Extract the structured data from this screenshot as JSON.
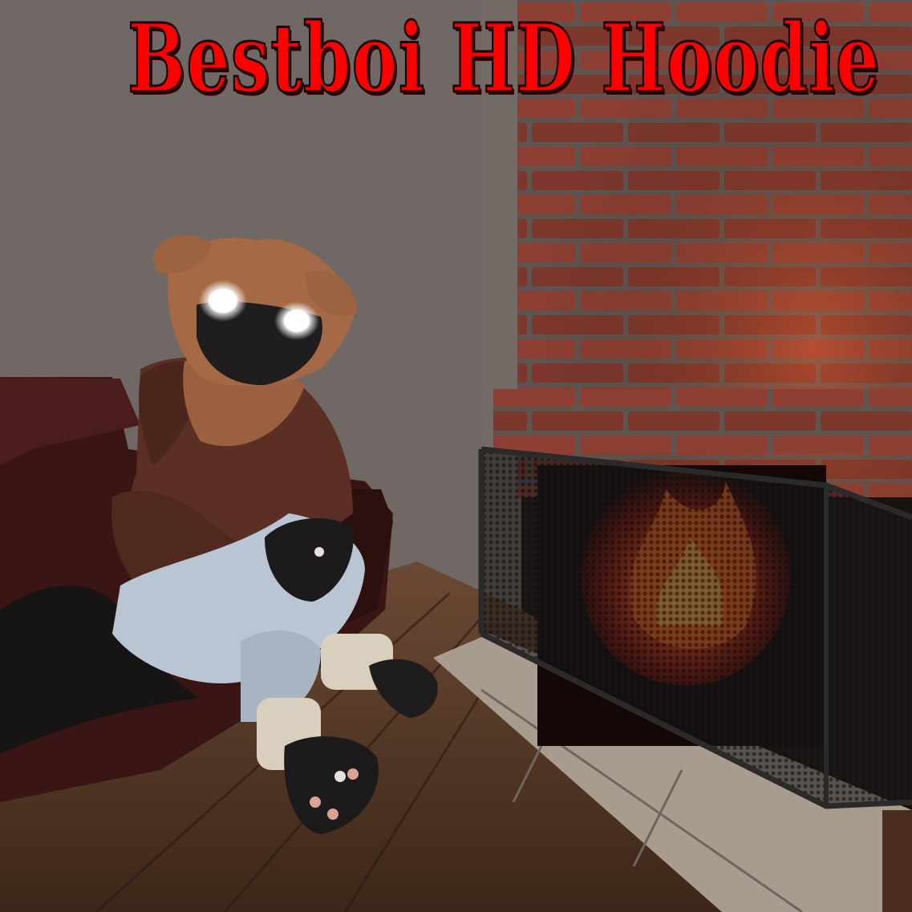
{
  "title": "Bestboi HD Hoodie",
  "colors": {
    "title_red": "#ff0000",
    "brick": "#8a3b2e",
    "mortar": "#5a5350",
    "wall": "#8e8682",
    "fire": "#ff5a1a"
  }
}
